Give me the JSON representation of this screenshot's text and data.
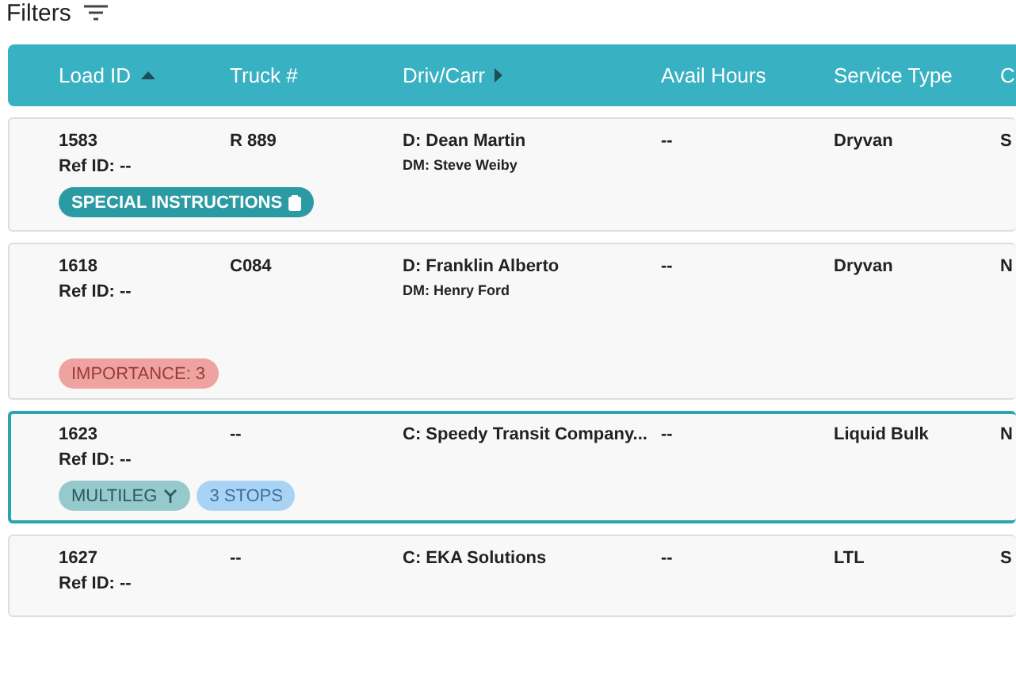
{
  "filters": {
    "label": "Filters"
  },
  "table": {
    "columns": [
      {
        "label": "Load ID",
        "sorted": true,
        "expand_arrow": false
      },
      {
        "label": "Truck #",
        "sorted": false,
        "expand_arrow": false
      },
      {
        "label": "Driv/Carr",
        "sorted": false,
        "expand_arrow": true
      },
      {
        "label": "Avail Hours",
        "sorted": false,
        "expand_arrow": false
      },
      {
        "label": "Service Type",
        "sorted": false,
        "expand_arrow": false
      },
      {
        "label": "C",
        "sorted": false,
        "expand_arrow": false
      }
    ],
    "rows": [
      {
        "selected": false,
        "load_id": "1583",
        "ref_id": "Ref ID: --",
        "truck": "R 889",
        "driver": "D: Dean Martin",
        "dm": "DM: Steve Weiby",
        "avail_hours": "--",
        "service_type": "Dryvan",
        "column_6": "S",
        "badges": [
          {
            "kind": "special",
            "label": "SPECIAL INSTRUCTIONS",
            "color": "#2b9ba3"
          }
        ]
      },
      {
        "selected": false,
        "load_id": "1618",
        "ref_id": "Ref ID: --",
        "truck": "C084",
        "driver": "D: Franklin Alberto",
        "dm": "DM: Henry Ford",
        "avail_hours": "--",
        "service_type": "Dryvan",
        "column_6": "N",
        "badges": [
          {
            "kind": "importance",
            "label": "IMPORTANCE: 3",
            "color": "#efa3a0"
          }
        ]
      },
      {
        "selected": true,
        "load_id": "1623",
        "ref_id": "Ref ID: --",
        "truck": "--",
        "driver": "C: Speedy Transit Company...",
        "avail_hours": "--",
        "service_type": "Liquid Bulk",
        "column_6": "N",
        "badges": [
          {
            "kind": "multileg",
            "label": "MULTILEG",
            "color": "#95c9cb"
          },
          {
            "kind": "stops",
            "label": "3 STOPS",
            "color": "#a9d3f5"
          }
        ]
      },
      {
        "selected": false,
        "load_id": "1627",
        "ref_id": "Ref ID: --",
        "truck": "--",
        "driver": "C: EKA Solutions",
        "avail_hours": "--",
        "service_type": "LTL",
        "column_6": "S",
        "badges": []
      }
    ]
  }
}
